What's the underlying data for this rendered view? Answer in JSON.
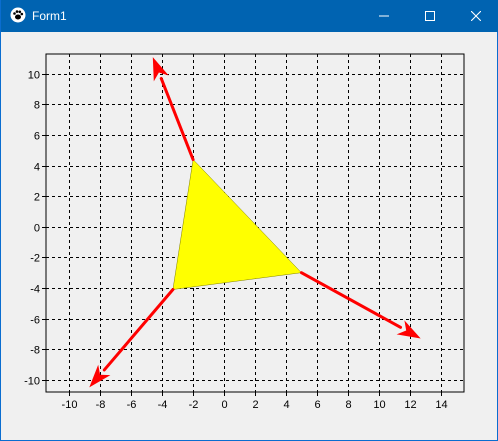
{
  "window": {
    "title": "Form1",
    "icon": "paw-app-icon",
    "buttons": [
      "minimize-icon",
      "maximize-icon",
      "close-icon"
    ]
  },
  "colors": {
    "titlebar": "#0063b1",
    "grid": "#000000",
    "triangle_fill": "#ffff00",
    "arrow": "#ff0000",
    "plot_background": "#f0f0f0"
  },
  "chart_data": {
    "type": "scatter",
    "title": "",
    "xlabel": "",
    "ylabel": "",
    "xlim": [
      -11.5,
      15.5
    ],
    "ylim": [
      -10.8,
      11.3
    ],
    "xticks": [
      -10,
      -8,
      -6,
      -4,
      -2,
      0,
      2,
      4,
      6,
      8,
      10,
      12,
      14
    ],
    "yticks": [
      -10,
      -8,
      -6,
      -4,
      -2,
      0,
      2,
      4,
      6,
      8,
      10
    ],
    "grid": true,
    "grid_style": "dashed",
    "triangle": {
      "vertices": [
        [
          -2.0,
          4.4
        ],
        [
          5.0,
          -3.0
        ],
        [
          -3.3,
          -4.1
        ]
      ],
      "fill": "yellow"
    },
    "arrows": [
      {
        "from": [
          -2.0,
          4.4
        ],
        "to": [
          -4.6,
          11.1
        ]
      },
      {
        "from": [
          5.0,
          -3.0
        ],
        "to": [
          12.7,
          -7.3
        ]
      },
      {
        "from": [
          -3.3,
          -4.1
        ],
        "to": [
          -8.7,
          -10.5
        ]
      }
    ]
  }
}
